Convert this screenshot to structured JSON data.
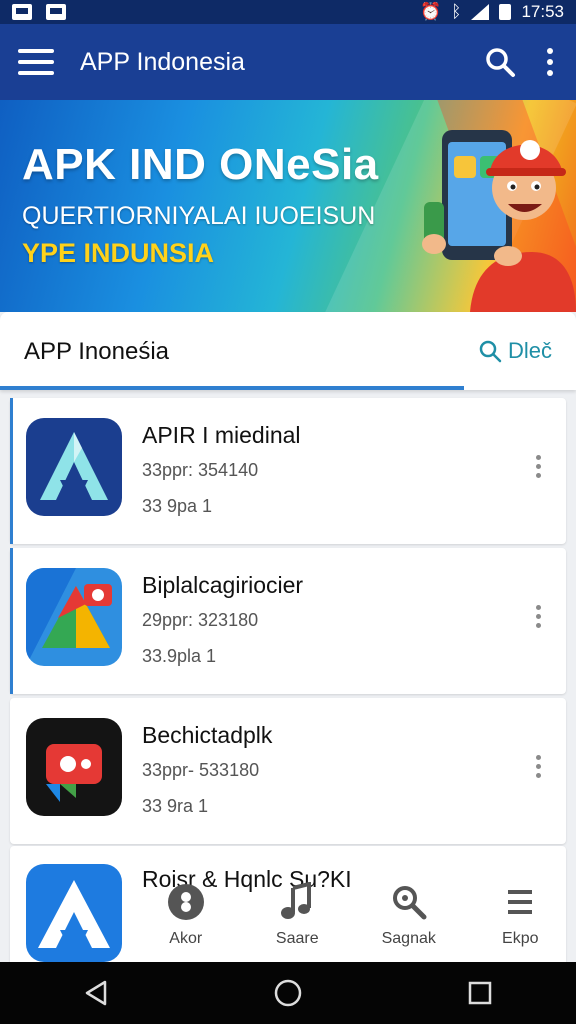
{
  "status_bar": {
    "time": "17:53",
    "icons": [
      "notification-icon",
      "notification-icon",
      "alarm-icon",
      "bluetooth-icon",
      "signal-icon",
      "battery-icon"
    ]
  },
  "app_bar": {
    "title": "APP Indonesia",
    "menu_icon": "hamburger-icon",
    "search_icon": "search-icon",
    "more_icon": "more-vert-icon"
  },
  "banner": {
    "headline": "APK IND ONeSia",
    "subline": "QUERTIORNIYALAI IUOEISUN",
    "tagline": "YPE INDUNSIA",
    "art": "mascot-with-phone"
  },
  "section": {
    "title": "APP Inoneśia",
    "action_label": "Dleč",
    "action_icon": "search-icon"
  },
  "apps": [
    {
      "name": "APIR I miedinal",
      "meta": "33ppr: 354140",
      "size": "33 9pa 1",
      "icon": "a-triangle-icon-navy"
    },
    {
      "name": "Biplalcagiriocier",
      "meta": "29ppr: 323180",
      "size": "33.9pla 1",
      "icon": "colorful-triangle-icon"
    },
    {
      "name": "Bechictadplk",
      "meta": "33ppr- 533180",
      "size": "33 9ra 1",
      "icon": "video-play-icon"
    },
    {
      "name": "Roisr & Hqnlc Su?KI",
      "meta": "",
      "size": "",
      "icon": "a-triangle-icon-blue"
    }
  ],
  "bottom_nav": [
    {
      "label": "Akor",
      "icon": "profile-circle-icon"
    },
    {
      "label": "Saare",
      "icon": "music-note-icon"
    },
    {
      "label": "Sagnak",
      "icon": "search-icon"
    },
    {
      "label": "Ekpo",
      "icon": "menu-icon"
    }
  ],
  "system_nav": [
    "back-icon",
    "home-icon",
    "recents-icon"
  ],
  "colors": {
    "app_bar": "#1a3f94",
    "status_bar": "#0e2a66",
    "accent": "#2f7fd0",
    "tab_action": "#1f8fa6"
  }
}
